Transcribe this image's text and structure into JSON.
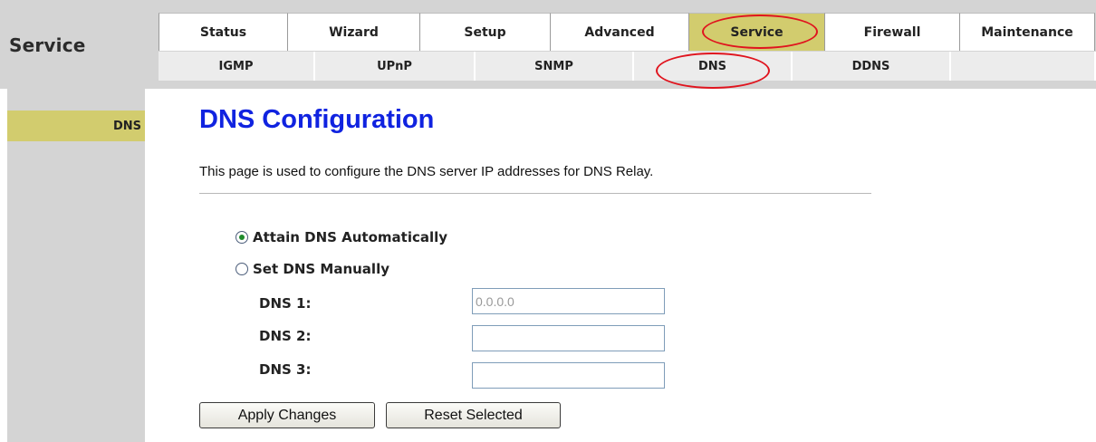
{
  "header": {
    "section_title": "Service",
    "main_tabs": [
      {
        "label": "Status"
      },
      {
        "label": "Wizard"
      },
      {
        "label": "Setup"
      },
      {
        "label": "Advanced"
      },
      {
        "label": "Service"
      },
      {
        "label": "Firewall"
      },
      {
        "label": "Maintenance"
      }
    ],
    "active_main_tab": "Service",
    "sub_tabs": [
      {
        "label": "IGMP"
      },
      {
        "label": "UPnP"
      },
      {
        "label": "SNMP"
      },
      {
        "label": "DNS"
      },
      {
        "label": "DDNS"
      },
      {
        "label": ""
      }
    ],
    "active_sub_tab": "DNS"
  },
  "sidebar": {
    "items": [
      {
        "label": "DNS",
        "active": true
      }
    ]
  },
  "main": {
    "title": "DNS Configuration",
    "description": "This page is used to configure the DNS server IP addresses for DNS Relay.",
    "options": [
      {
        "label": "Attain DNS Automatically",
        "checked": true
      },
      {
        "label": "Set DNS Manually",
        "checked": false
      }
    ],
    "dns_fields": [
      {
        "label": "DNS 1:",
        "value": "0.0.0.0"
      },
      {
        "label": "DNS 2:",
        "value": ""
      },
      {
        "label": "DNS 3:",
        "value": ""
      }
    ],
    "apply_button": "Apply Changes",
    "reset_button": "Reset Selected"
  },
  "colors": {
    "active_tab": "#d2cc6e",
    "title_blue": "#1023e0",
    "annotation_red": "#e0141e"
  }
}
